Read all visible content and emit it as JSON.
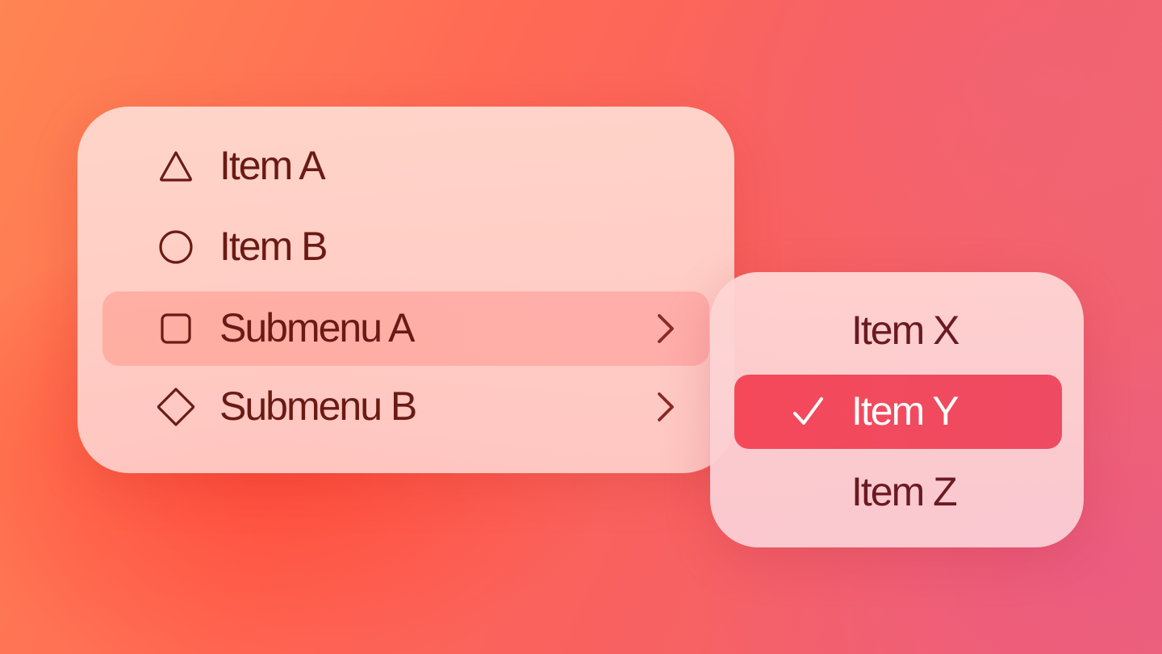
{
  "main_menu": {
    "items": [
      {
        "label": "Item A",
        "icon": "triangle-icon",
        "has_submenu": false,
        "highlighted": false
      },
      {
        "label": "Item B",
        "icon": "circle-icon",
        "has_submenu": false,
        "highlighted": false
      },
      {
        "label": "Submenu A",
        "icon": "square-icon",
        "has_submenu": true,
        "highlighted": true
      },
      {
        "label": "Submenu B",
        "icon": "diamond-icon",
        "has_submenu": true,
        "highlighted": false
      }
    ]
  },
  "submenu": {
    "items": [
      {
        "label": "Item X",
        "checked": false
      },
      {
        "label": "Item Y",
        "checked": true
      },
      {
        "label": "Item Z",
        "checked": false
      }
    ]
  },
  "colors": {
    "text": "#6a1a14",
    "selected_background": "#f5495a",
    "selected_text": "#ffffff"
  }
}
